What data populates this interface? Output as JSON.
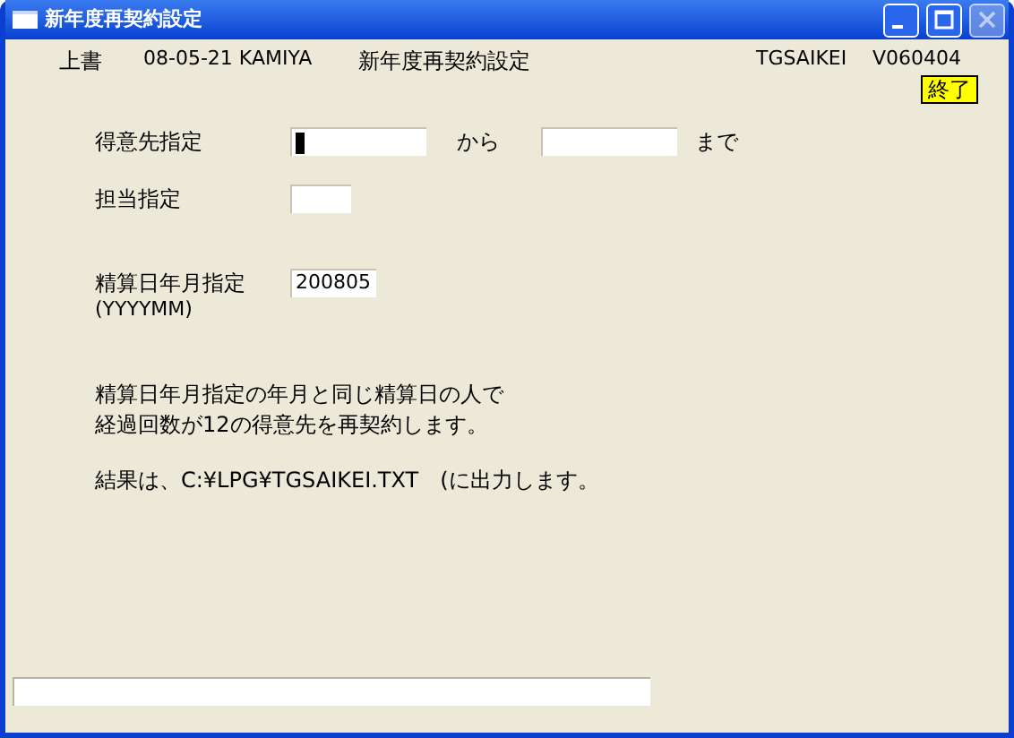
{
  "window": {
    "title": "新年度再契約設定",
    "controls": [
      {
        "kind": "minimize",
        "disabled": false
      },
      {
        "kind": "maximize",
        "disabled": false
      },
      {
        "kind": "close",
        "disabled": true
      }
    ]
  },
  "header": {
    "mode": "上書",
    "date_user": "08-05-21 KAMIYA",
    "screen_title": "新年度再契約設定",
    "program_id": "TGSAIKEI",
    "version": "V060404"
  },
  "exit_button": {
    "label": "終了"
  },
  "customer_range": {
    "label": "得意先指定",
    "from": {
      "focused": true
    },
    "from_label": "から",
    "to": {
      "focused": false
    },
    "to_label": "まで"
  },
  "staff": {
    "label": "担当指定"
  },
  "settlement": {
    "label": "精算日年月指定",
    "format": "(YYYYMM)",
    "value": "200805"
  },
  "description": [
    "精算日年月指定の年月と同じ精算日の人で",
    "経過回数が12の得意先を再契約します。"
  ],
  "output_note": "結果は、C:¥LPG¥TGSAIKEI.TXT　(に出力します。"
}
